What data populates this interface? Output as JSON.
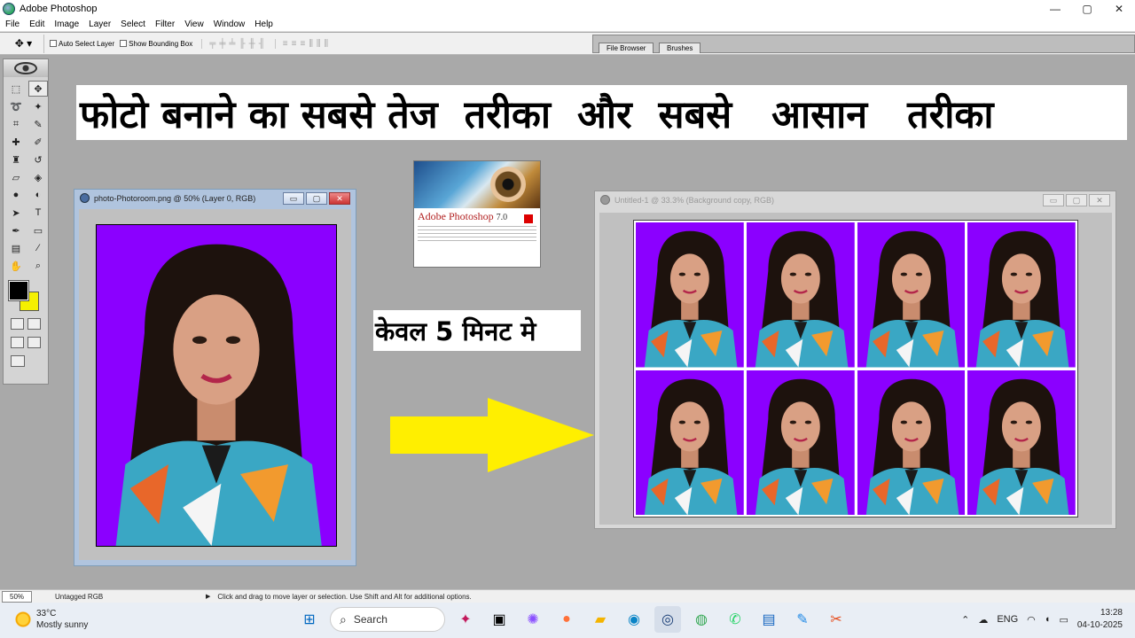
{
  "window": {
    "title": "Adobe Photoshop",
    "controls": {
      "minimize": "—",
      "maximize": "▢",
      "close": "✕"
    }
  },
  "menu": [
    "File",
    "Edit",
    "Image",
    "Layer",
    "Select",
    "Filter",
    "View",
    "Window",
    "Help"
  ],
  "options_bar": {
    "tool_preset_icon": "move-tool-icon",
    "auto_select_label": "Auto Select Layer",
    "bounding_box_label": "Show Bounding Box",
    "palette_tabs": [
      "File Browser",
      "Brushes"
    ]
  },
  "toolbox": {
    "tools": [
      "marquee-icon",
      "move-icon",
      "lasso-icon",
      "magic-wand-icon",
      "crop-icon",
      "slice-icon",
      "healing-brush-icon",
      "brush-icon",
      "clone-stamp-icon",
      "history-brush-icon",
      "eraser-icon",
      "paint-bucket-icon",
      "blur-icon",
      "dodge-icon",
      "path-select-icon",
      "type-icon",
      "pen-icon",
      "rectangle-icon",
      "notes-icon",
      "eyedropper-icon",
      "hand-icon",
      "zoom-icon"
    ],
    "foreground_color": "#000000",
    "background_color": "#f5f000"
  },
  "banner": {
    "segments": [
      "फोटो बनाने का सबसे तेज",
      "तरीका",
      "और",
      "सबसे",
      "आसान",
      "तरीका"
    ]
  },
  "doc_left": {
    "title": "photo-Photoroom.png @ 50% (Layer 0, RGB)",
    "backdrop_color": "#8b00ff"
  },
  "splash": {
    "brand": "Adobe Photoshop",
    "version": "7.0"
  },
  "caption": "केवल 5 मिनट मे",
  "doc_right": {
    "title": "Untitled-1 @ 33.3% (Background copy, RGB)",
    "grid": {
      "rows": 2,
      "cols": 4
    }
  },
  "status_bar": {
    "zoom": "50%",
    "doc_info": "Untagged RGB",
    "hint": "Click and drag to move layer or selection.  Use Shift and Alt for additional options."
  },
  "taskbar": {
    "weather_temp": "33°C",
    "weather_desc": "Mostly sunny",
    "search_placeholder": "Search",
    "apps": [
      "start-icon",
      "search-box",
      "pen-app-icon",
      "task-view-icon",
      "copilot-icon",
      "firefox-icon",
      "file-explorer-icon",
      "edge-icon",
      "photoshop-icon",
      "chrome-icon",
      "whatsapp-icon",
      "store-icon",
      "paint-icon",
      "snipping-tool-icon"
    ],
    "language": "ENG",
    "time": "13:28",
    "date": "04-10-2025"
  }
}
